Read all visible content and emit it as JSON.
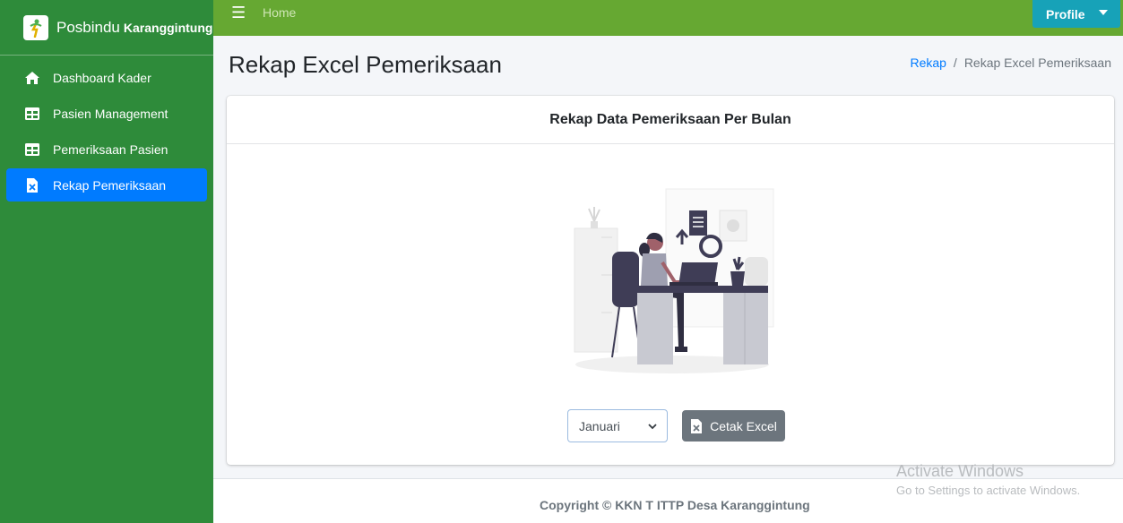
{
  "sidebar": {
    "brand": {
      "name": "Posbindu",
      "sub": "Karanggintung"
    },
    "items": [
      {
        "label": "Dashboard Kader",
        "icon": "home-icon"
      },
      {
        "label": "Pasien Management",
        "icon": "table-icon"
      },
      {
        "label": "Pemeriksaan Pasien",
        "icon": "table-icon"
      },
      {
        "label": "Rekap Pemeriksaan",
        "icon": "excel-file-icon",
        "active": true
      }
    ]
  },
  "topbar": {
    "menu_icon": "hamburger-icon",
    "home": "Home",
    "profile": "Profile"
  },
  "page": {
    "title": "Rekap Excel Pemeriksaan",
    "breadcrumb": {
      "link": "Rekap",
      "sep": "/",
      "current": "Rekap Excel Pemeriksaan"
    }
  },
  "card": {
    "title": "Rekap Data Pemeriksaan Per Bulan",
    "month_select": {
      "selected": "Januari"
    },
    "print_button": "Cetak Excel"
  },
  "footer": {
    "copyright": "Copyright © KKN T ITTP Desa Karanggintung"
  },
  "watermark": {
    "title": "Activate Windows",
    "sub": "Go to Settings to activate Windows."
  },
  "colors": {
    "sidebar": "#2e8b3a",
    "topbar": "#66a832",
    "active": "#007bff",
    "profile": "#17a2b8",
    "button": "#6c757d"
  }
}
